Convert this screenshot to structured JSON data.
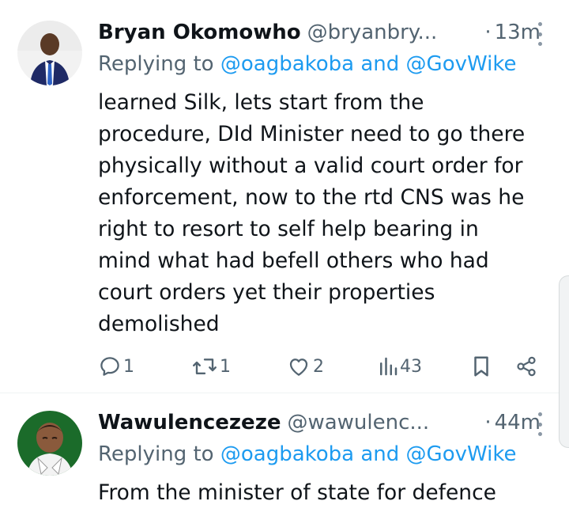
{
  "tweets": [
    {
      "name": "Bryan Okomowho",
      "handle": "@bryanbry...",
      "dot": "·",
      "time": "13m",
      "replying_prefix": "Replying to ",
      "replying_users": "@oagbakoba and @GovWike",
      "body": "learned Silk, lets start from the\nprocedure, DId Minister need to go there\nphysically without a valid court order for\nenforcement, now to the rtd CNS was he\nright to resort to self help bearing in\nmind what had befell others who had\ncourt orders yet their properties\ndemolished",
      "replies": "1",
      "reposts": "1",
      "likes": "2",
      "views": "43"
    },
    {
      "name": "Wawulencezeze",
      "handle": "@wawulenc...",
      "dot": "·",
      "time": "44m",
      "replying_prefix": "Replying to ",
      "replying_users": "@oagbakoba and @GovWike",
      "body": "From the minister of state for defence"
    }
  ],
  "colors": {
    "text": "#0f1419",
    "secondary": "#536471",
    "link": "#1d9bf0",
    "divider": "#eff3f4"
  },
  "icons": [
    "reply-icon",
    "repost-icon",
    "like-icon",
    "views-icon",
    "bookmark-icon",
    "share-icon",
    "more-icon"
  ]
}
